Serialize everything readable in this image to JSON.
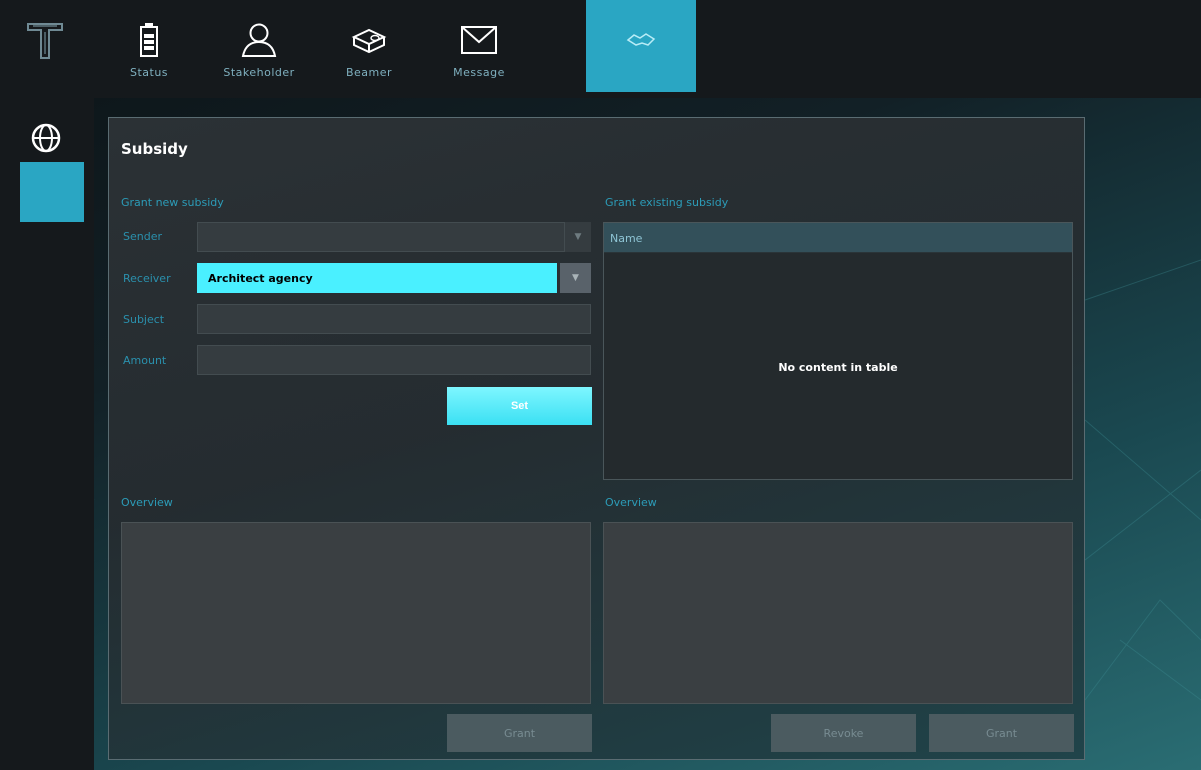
{
  "nav": {
    "tabs": [
      {
        "label": "Status",
        "icon": "battery-icon"
      },
      {
        "label": "Stakeholder",
        "icon": "person-icon"
      },
      {
        "label": "Beamer",
        "icon": "projector-icon"
      },
      {
        "label": "Message",
        "icon": "envelope-icon"
      },
      {
        "label": "",
        "icon": "handshake-icon",
        "active": true
      }
    ]
  },
  "panel": {
    "title": "Subsidy",
    "grant_new": {
      "section_label": "Grant new subsidy",
      "sender_label": "Sender",
      "sender_value": "",
      "receiver_label": "Receiver",
      "receiver_value": "Architect agency",
      "subject_label": "Subject",
      "subject_value": "",
      "amount_label": "Amount",
      "amount_value": "",
      "set_button": "Set"
    },
    "grant_existing": {
      "section_label": "Grant existing subsidy",
      "column_name": "Name",
      "empty_text": "No content in table"
    },
    "overview_left_label": "Overview",
    "overview_right_label": "Overview",
    "grant_left_button": "Grant",
    "revoke_button": "Revoke",
    "grant_right_button": "Grant"
  },
  "colors": {
    "accent": "#2aa6c3",
    "highlight": "#4af0ff",
    "bar": "#15191c"
  }
}
